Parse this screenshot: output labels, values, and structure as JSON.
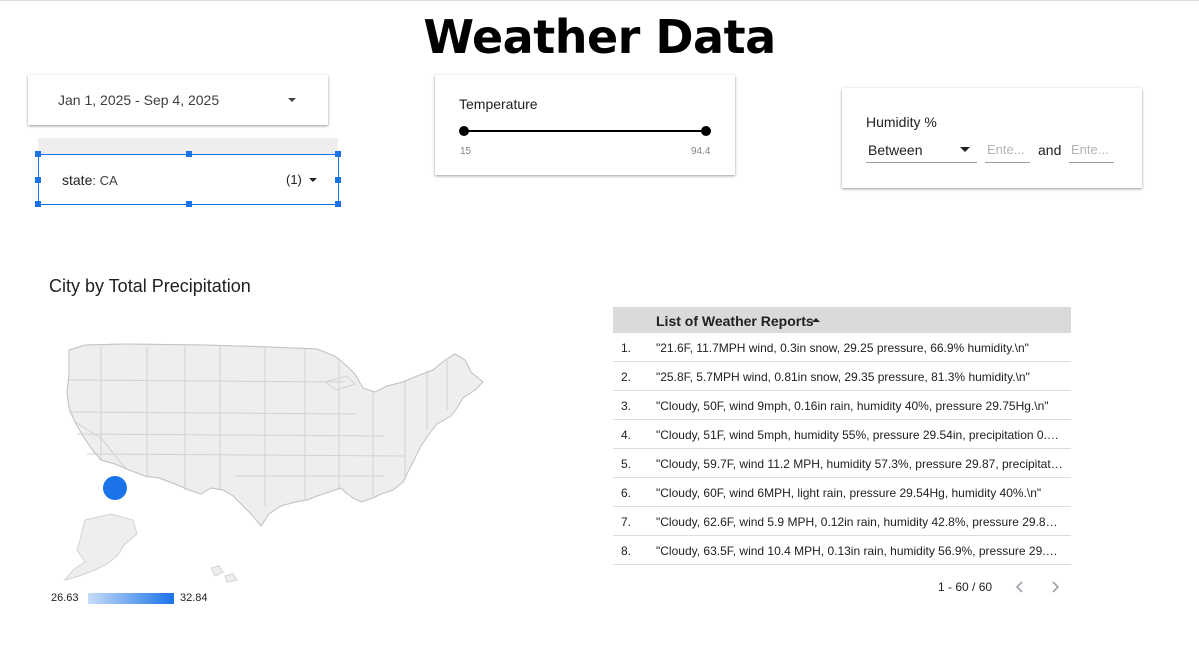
{
  "page": {
    "title": "Weather Data"
  },
  "date_range": {
    "value": "Jan 1, 2025 - Sep 4, 2025",
    "icon": "chevron-down-icon"
  },
  "state_filter": {
    "field": "state",
    "value": ": CA",
    "count": "(1)",
    "icon": "chevron-down-icon"
  },
  "temperature": {
    "label": "Temperature",
    "min": "15",
    "max": "94.4",
    "low_fraction": 0,
    "high_fraction": 1
  },
  "humidity": {
    "label": "Humidity %",
    "operator": "Between",
    "input1_placeholder": "Ente...",
    "input2_placeholder": "Ente...",
    "and_label": "and"
  },
  "map": {
    "title": "City by Total Precipitation",
    "legend_min": "26.63",
    "legend_max": "32.84",
    "colors": {
      "land": "#eeeeee",
      "border": "#d6d6d6",
      "bubble": "#1a73e8"
    }
  },
  "table": {
    "header": "List of Weather Reports",
    "sort_icon": "sort-ascending-icon",
    "rows": [
      {
        "num": "1.",
        "text": "\"21.6F, 11.7MPH wind, 0.3in snow, 29.25 pressure, 66.9% humidity.\\n\""
      },
      {
        "num": "2.",
        "text": "\"25.8F, 5.7MPH wind, 0.81in snow, 29.35 pressure, 81.3% humidity.\\n\""
      },
      {
        "num": "3.",
        "text": "\"Cloudy, 50F, wind 9mph, 0.16in rain, humidity 40%, pressure 29.75Hg.\\n\""
      },
      {
        "num": "4.",
        "text": "\"Cloudy, 51F, wind 5mph, humidity 55%, pressure 29.54in, precipitation 0.05..."
      },
      {
        "num": "5.",
        "text": "\"Cloudy, 59.7F, wind 11.2 MPH, humidity 57.3%, pressure 29.87, precipitatio..."
      },
      {
        "num": "6.",
        "text": "\"Cloudy, 60F, wind 6MPH, light rain, pressure 29.54Hg, humidity 40%.\\n\""
      },
      {
        "num": "7.",
        "text": "\"Cloudy, 62.6F, wind 5.9 MPH, 0.12in rain, humidity 42.8%, pressure 29.89H..."
      },
      {
        "num": "8.",
        "text": "\"Cloudy, 63.5F, wind 10.4 MPH, 0.13in rain, humidity 56.9%, pressure 29.74..."
      }
    ],
    "pagination": "1 - 60 / 60"
  }
}
